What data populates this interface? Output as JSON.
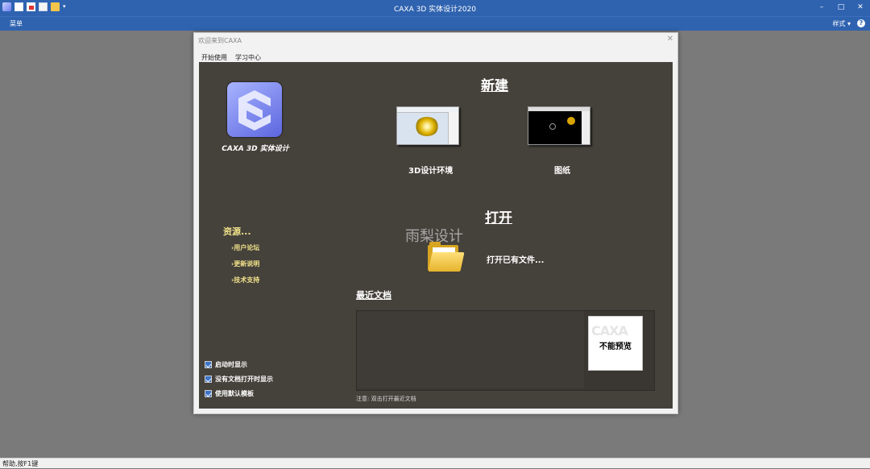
{
  "app": {
    "title": "CAXA 3D 实体设计2020",
    "menu_label": "菜单",
    "style_label": "样式",
    "status_text": "帮助,按F1键"
  },
  "window_buttons": {
    "minimize": "–",
    "maximize": "□",
    "close": "✕"
  },
  "quick_access": [
    "logo-icon",
    "new-icon",
    "open-icon",
    "save-icon",
    "folder-icon",
    "dropdown-icon"
  ],
  "dialog": {
    "title": "欢迎来到CAXA",
    "tabs": [
      {
        "label": "开始使用",
        "active": true
      },
      {
        "label": "学习中心",
        "active": false
      }
    ],
    "logo_text": "CAXA 3D 实体设计",
    "resources": {
      "title": "资源...",
      "items": [
        "›用户论坛",
        "›更新说明",
        "›技术支持"
      ]
    },
    "checkboxes": [
      {
        "label": "启动时显示",
        "checked": true
      },
      {
        "label": "没有文档打开时显示",
        "checked": true
      },
      {
        "label": "使用默认模板",
        "checked": true
      }
    ],
    "new_section": {
      "title": "新建",
      "items": [
        {
          "label": "3D设计环境"
        },
        {
          "label": "图纸"
        }
      ]
    },
    "open_section": {
      "title": "打开",
      "open_existing": "打开已有文件..."
    },
    "watermark": "雨梨设计",
    "recent": {
      "title": "最近文档",
      "preview_text": "不能预览",
      "preview_watermark": "CAXA",
      "note": "注意: 双击打开最近文档"
    }
  },
  "colors": {
    "titlebar": "#2f63b0",
    "panel": "#45413b",
    "resource_text": "#f1e38a"
  }
}
